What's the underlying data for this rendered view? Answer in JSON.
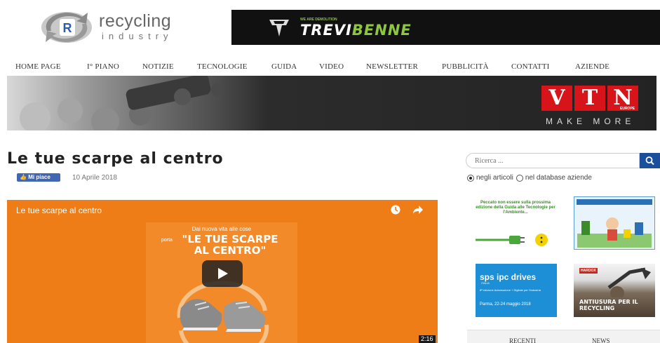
{
  "logo": {
    "letter": "R",
    "name": "recycling",
    "sub": "industry"
  },
  "top_banner": {
    "brand_a": "TREVI",
    "brand_b": "BENNE",
    "small": "WE ARE DEMOLITION"
  },
  "nav": {
    "items": [
      "HOME PAGE",
      "I° PIANO",
      "NOTIZIE",
      "TECNOLOGIE",
      "GUIDA",
      "VIDEO",
      "NEWSLETTER",
      "PUBBLICITÀ",
      "CONTATTI",
      "AZIENDE"
    ]
  },
  "hero": {
    "letters": [
      "V",
      "T",
      "N"
    ],
    "europe": "EUROPE",
    "tagline": "MAKE MORE"
  },
  "article": {
    "title": "Le tue scarpe al centro",
    "like_label": "Mi piace",
    "date": "10 Aprile 2018"
  },
  "video": {
    "title": "Le tue scarpe al centro",
    "poster_top": "Dai nuova vita alle cose",
    "poster_porta": "porta",
    "poster_big": "\"LE TUE SCARPE AL CENTRO\"",
    "duration": "2:16"
  },
  "sidebar": {
    "search_placeholder": "Ricerca ...",
    "radio_articles": "negli articoli",
    "radio_database": "nel database aziende",
    "ad1_text": "Peccato non essere sulla prossima edizione della Guida alle Tecnologie per l'Ambiente...",
    "ad3_title": "sps ipc drives",
    "ad3_sub": "ITALIA",
    "ad3_desc": "8ª edizione Automazione + Digitale per l'Industria",
    "ad3_date": "Parma, 22-24 maggio 2018",
    "ad4_brand": "HARDOX",
    "ad4_text": "ANTIUSURA PER IL RECYCLING",
    "tabs": [
      "RECENTI",
      "NEWS"
    ]
  },
  "colors": {
    "accent": "#1b4f9c",
    "video_orange": "#ee7d18",
    "vtn_red": "#d7141a"
  }
}
